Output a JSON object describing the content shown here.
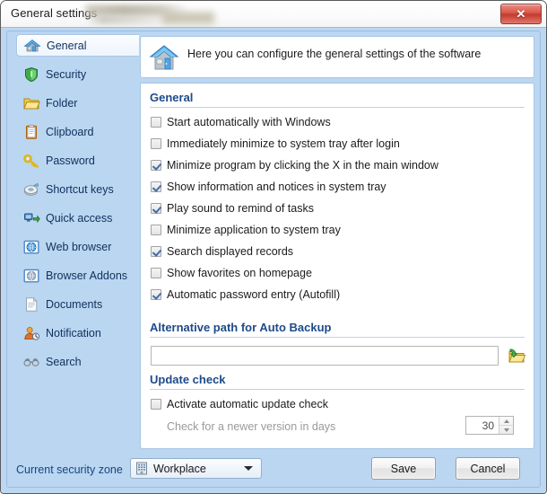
{
  "window": {
    "title": "General settings",
    "close_label": "✕",
    "redacted_note": ""
  },
  "sidebar": {
    "items": [
      {
        "label": "General",
        "icon": "home-icon",
        "selected": true
      },
      {
        "label": "Security",
        "icon": "shield-icon",
        "selected": false
      },
      {
        "label": "Folder",
        "icon": "folder-icon",
        "selected": false
      },
      {
        "label": "Clipboard",
        "icon": "clipboard-icon",
        "selected": false
      },
      {
        "label": "Password",
        "icon": "key-icon",
        "selected": false
      },
      {
        "label": "Shortcut keys",
        "icon": "keyboard-keys-icon",
        "selected": false
      },
      {
        "label": "Quick access",
        "icon": "quick-access-icon",
        "selected": false
      },
      {
        "label": "Web browser",
        "icon": "globe-icon",
        "selected": false
      },
      {
        "label": "Browser Addons",
        "icon": "globe-addon-icon",
        "selected": false
      },
      {
        "label": "Documents",
        "icon": "document-icon",
        "selected": false
      },
      {
        "label": "Notification",
        "icon": "user-clock-icon",
        "selected": false
      },
      {
        "label": "Search",
        "icon": "binoculars-icon",
        "selected": false
      }
    ]
  },
  "info": {
    "icon": "house-icon",
    "text": "Here you can configure the general settings of the software"
  },
  "general_group": {
    "heading": "General",
    "options": [
      {
        "label": "Start automatically with Windows",
        "checked": false
      },
      {
        "label": "Immediately minimize to system tray after login",
        "checked": false
      },
      {
        "label": "Minimize program by clicking the X in the main window",
        "checked": true
      },
      {
        "label": "Show information and notices in system tray",
        "checked": true
      },
      {
        "label": "Play sound to remind of tasks",
        "checked": true
      },
      {
        "label": "Minimize application to system tray",
        "checked": false
      },
      {
        "label": "Search displayed records",
        "checked": true
      },
      {
        "label": "Show favorites on homepage",
        "checked": false
      },
      {
        "label": "Automatic password entry (Autofill)",
        "checked": true
      }
    ]
  },
  "backup_group": {
    "heading": "Alternative path for Auto Backup",
    "path_value": "",
    "path_placeholder": "",
    "browse_icon": "open-folder-icon"
  },
  "update_group": {
    "heading": "Update check",
    "activate_label": "Activate automatic update check",
    "activate_checked": false,
    "interval_label": "Check for a newer version in days",
    "interval_value": "30",
    "interval_disabled": true
  },
  "footer": {
    "zone_label": "Current security zone",
    "zone_value": "Workplace",
    "zone_icon": "building-icon",
    "save_label": "Save",
    "cancel_label": "Cancel"
  },
  "colors": {
    "body_blue": "#bcd7f2",
    "heading_blue": "#1e4a8a",
    "panel_border": "#a8c6e5",
    "close_red": "#c5382c"
  }
}
